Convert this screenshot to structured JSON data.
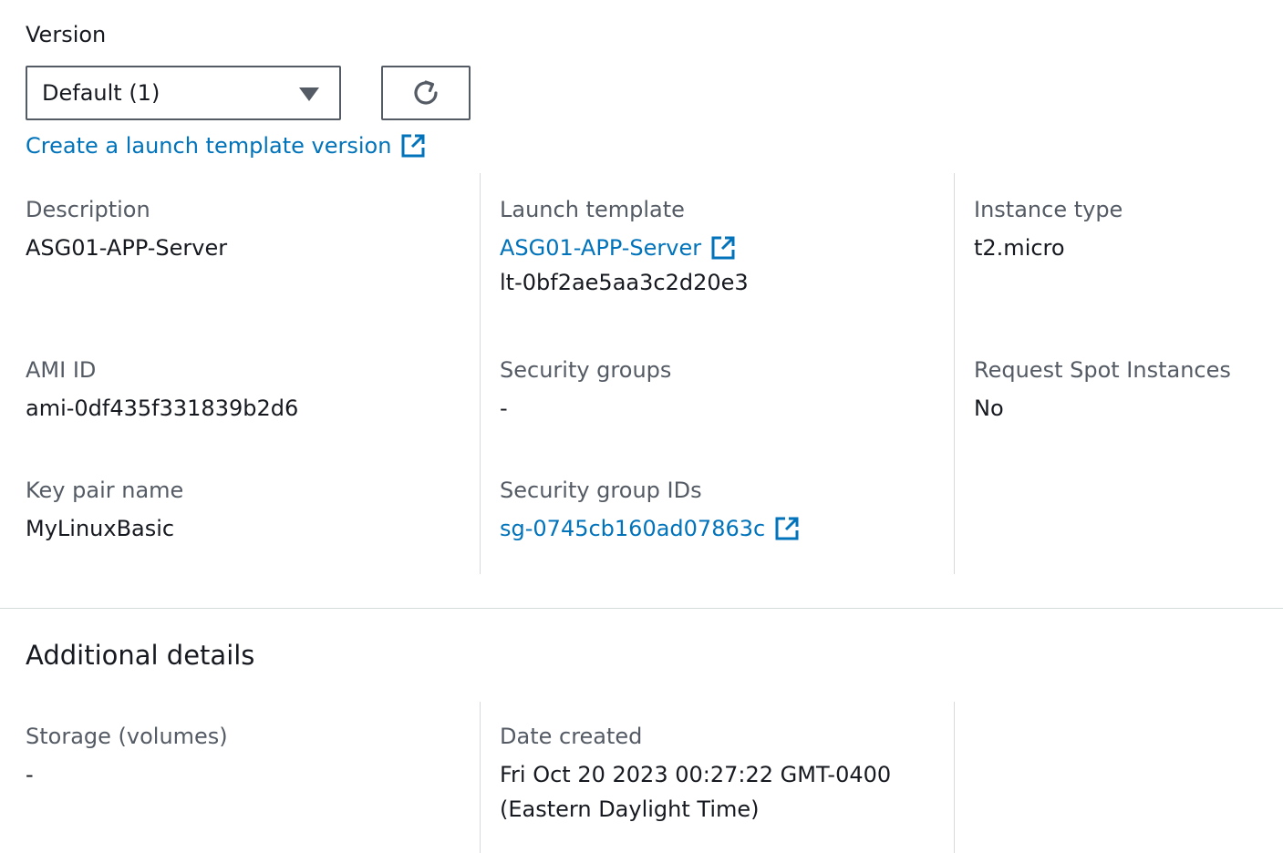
{
  "version": {
    "label": "Version",
    "selected": "Default (1)",
    "create_link": "Create a launch template version"
  },
  "details": {
    "description": {
      "label": "Description",
      "value": "ASG01-APP-Server"
    },
    "launch_template": {
      "label": "Launch template",
      "link": "ASG01-APP-Server",
      "id": "lt-0bf2ae5aa3c2d20e3"
    },
    "instance_type": {
      "label": "Instance type",
      "value": "t2.micro"
    },
    "ami_id": {
      "label": "AMI ID",
      "value": "ami-0df435f331839b2d6"
    },
    "security_groups": {
      "label": "Security groups",
      "value": "-"
    },
    "request_spot": {
      "label": "Request Spot Instances",
      "value": "No"
    },
    "key_pair": {
      "label": "Key pair name",
      "value": "MyLinuxBasic"
    },
    "security_group_ids": {
      "label": "Security group IDs",
      "link": "sg-0745cb160ad07863c"
    }
  },
  "additional": {
    "title": "Additional details",
    "storage": {
      "label": "Storage (volumes)",
      "value": "-"
    },
    "date_created": {
      "label": "Date created",
      "value_line1": "Fri Oct 20 2023 00:27:22 GMT-0400",
      "value_line2": "(Eastern Daylight Time)"
    }
  },
  "colors": {
    "link": "#0073bb",
    "label": "#545b64",
    "text": "#16191f",
    "divider": "#d5dbdb"
  },
  "icons": [
    "caret-down-icon",
    "refresh-icon",
    "external-link-icon"
  ]
}
